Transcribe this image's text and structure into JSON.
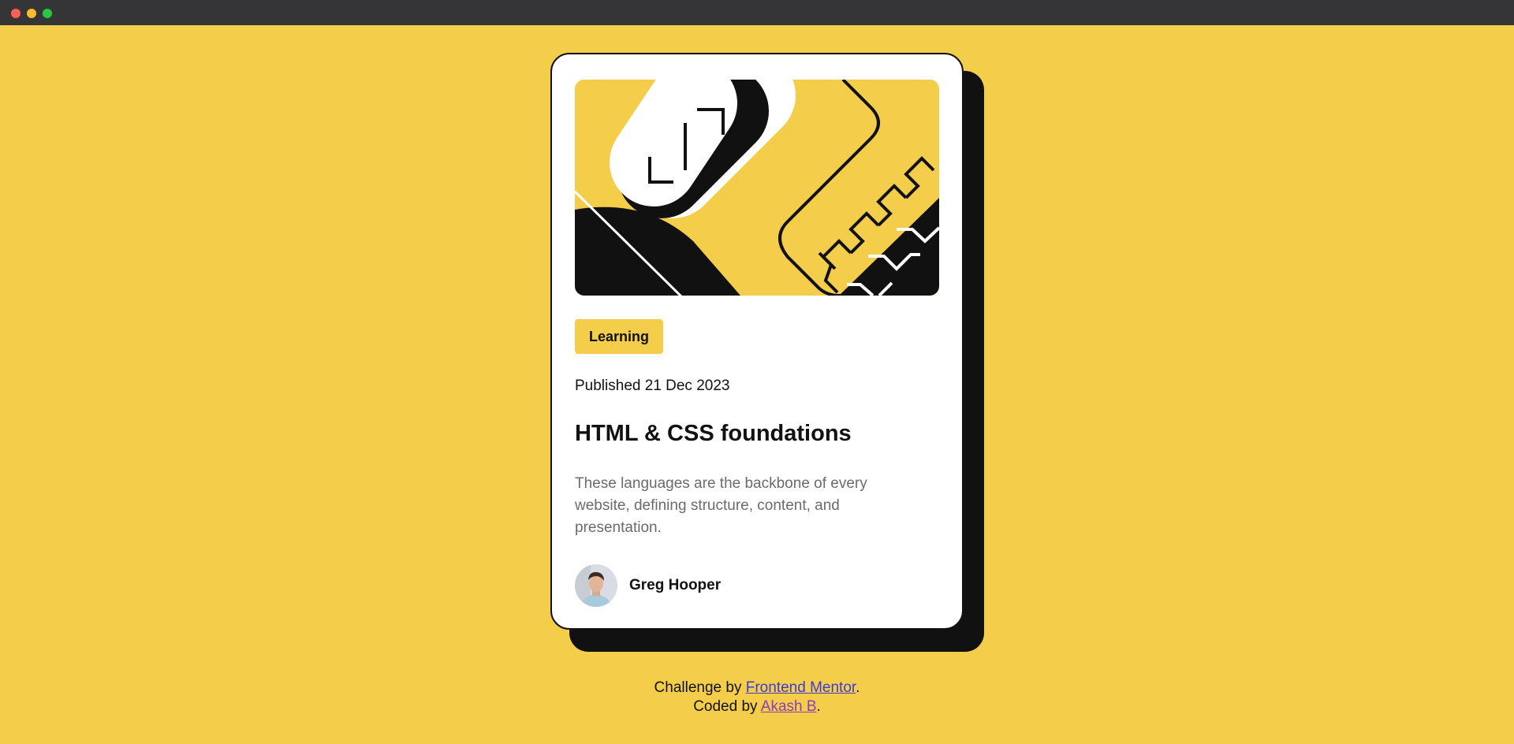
{
  "window": {
    "controls": [
      "close",
      "minimize",
      "maximize"
    ]
  },
  "card": {
    "image_description_icon": "illustration-article",
    "tag": "Learning",
    "published": "Published 21 Dec 2023",
    "title": "HTML & CSS foundations",
    "description": "These languages are the backbone of every website, defining structure, content, and presentation.",
    "author": {
      "name": "Greg Hooper",
      "avatar_icon": "avatar-photo"
    }
  },
  "attribution": {
    "line1_prefix": "Challenge by ",
    "line1_link": "Frontend Mentor",
    "line1_suffix": ".",
    "line2_prefix": "Coded by ",
    "line2_link": "Akash B",
    "line2_suffix": "."
  },
  "colors": {
    "background": "#f4ce4b",
    "card": "#ffffff",
    "ink": "#111111",
    "muted": "#6b6b6b",
    "link": "#3e3ad6",
    "visited_link": "#8c3db8"
  }
}
